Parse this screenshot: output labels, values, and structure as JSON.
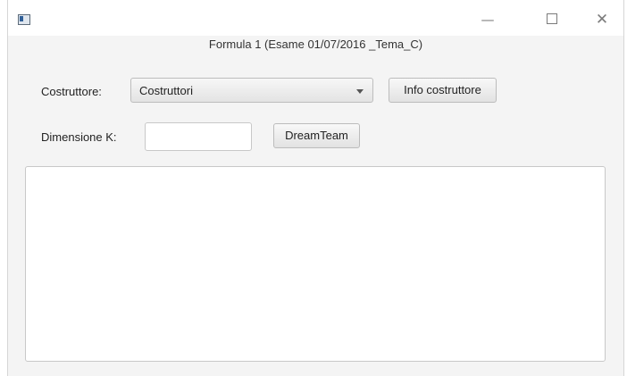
{
  "window": {
    "title": "Formula 1 (Esame 01/07/2016 _Tema_C)",
    "controls": {
      "minimize": "—",
      "close": "✕"
    }
  },
  "form": {
    "costruttore_label": "Costruttore:",
    "combo_value": "Costruttori",
    "info_button": "Info costruttore",
    "dimensione_label": "Dimensione K:",
    "k_value": "",
    "dreamteam_button": "DreamTeam",
    "output_text": ""
  }
}
